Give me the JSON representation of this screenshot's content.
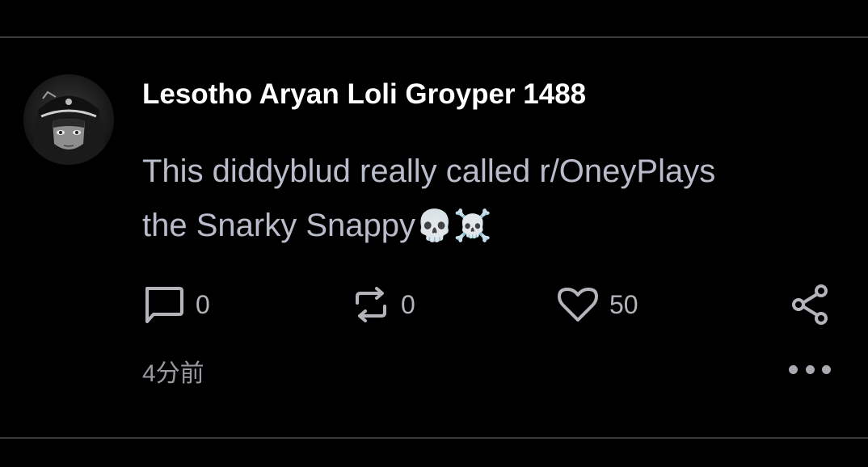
{
  "post": {
    "author": "Lesotho Aryan Loli Groyper 1488",
    "text_line_1": "This diddyblud really called r/OneyPlays",
    "text_line_2": "the Snarky Snappy",
    "emojis": "💀☠️",
    "timestamp": "4分前"
  },
  "actions": {
    "reply_icon": "comment-icon",
    "reply_count": "0",
    "repost_icon": "repost-icon",
    "repost_count": "0",
    "like_icon": "heart-icon",
    "like_count": "50",
    "share_icon": "share-icon",
    "more_icon": "more-horizontal-icon"
  },
  "colors": {
    "background": "#000000",
    "author": "#ffffff",
    "body_text": "#b9bccb",
    "icon": "#b4b4bb",
    "divider": "#3a3a3e"
  }
}
